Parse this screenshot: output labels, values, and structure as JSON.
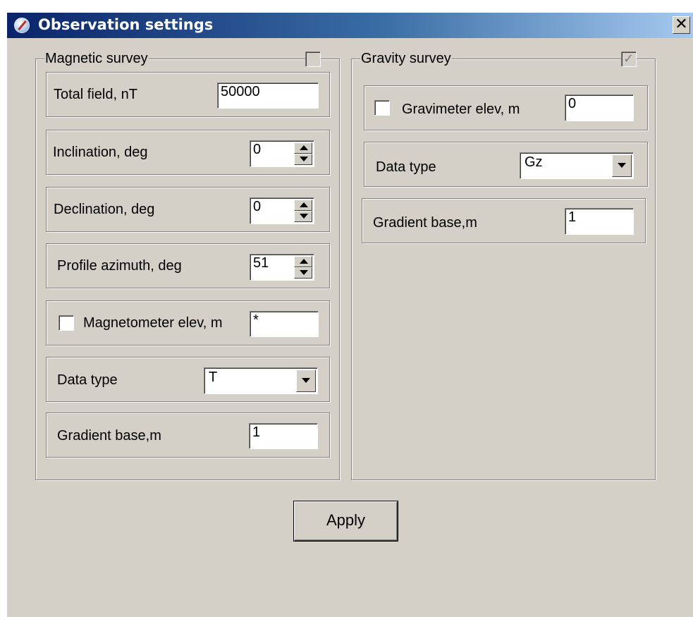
{
  "window": {
    "title": "Observation settings",
    "close_glyph": "✕"
  },
  "magnetic": {
    "label": "Magnetic survey",
    "enabled": false,
    "total_field": {
      "label": "Total field, nT",
      "value": "50000"
    },
    "inclination": {
      "label": "Inclination, deg",
      "value": "0"
    },
    "declination": {
      "label": "Declination, deg",
      "value": "0"
    },
    "azimuth": {
      "label": "Profile azimuth, deg",
      "value": "51"
    },
    "elevation": {
      "label": "Magnetometer elev, m",
      "value": "*",
      "checked": false
    },
    "data_type": {
      "label": "Data type",
      "value": "T"
    },
    "gradient": {
      "label": "Gradient base,m",
      "value": "1"
    }
  },
  "gravity": {
    "label": "Gravity survey",
    "enabled": true,
    "elevation": {
      "label": "Gravimeter elev, m",
      "value": "0",
      "checked": false
    },
    "data_type": {
      "label": "Data type",
      "value": "Gz"
    },
    "gradient": {
      "label": "Gradient base,m",
      "value": "1"
    }
  },
  "buttons": {
    "apply": "Apply"
  },
  "icons": {
    "app": "compass-icon",
    "close": "close-icon",
    "spin_up": "arrow-up-icon",
    "spin_down": "arrow-down-icon",
    "dropdown": "chevron-down-icon"
  },
  "colors": {
    "title_start": "#0a246a",
    "title_end": "#a6caf0",
    "face": "#d4d0c8"
  }
}
